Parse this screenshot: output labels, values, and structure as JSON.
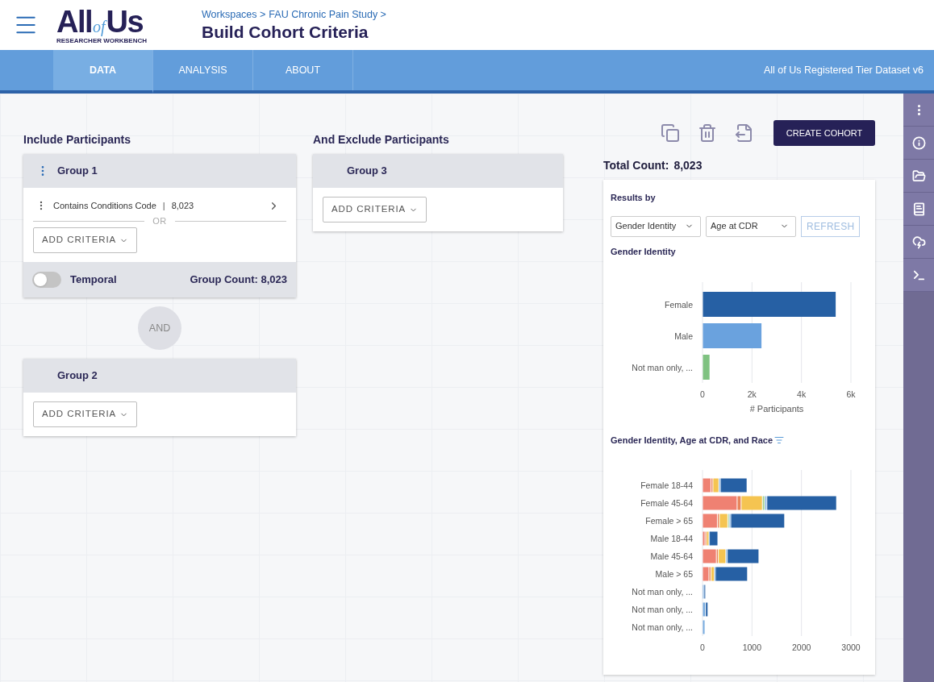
{
  "header": {
    "logo": {
      "word_all": "All",
      "word_of": "of",
      "word_us": "Us",
      "tagline": "RESEARCHER WORKBENCH"
    },
    "breadcrumb": [
      "Workspaces >",
      "FAU Chronic Pain Study >"
    ],
    "title": "Build Cohort Criteria"
  },
  "nav": {
    "tabs": [
      {
        "label": "DATA",
        "selected": true
      },
      {
        "label": "ANALYSIS",
        "selected": false
      },
      {
        "label": "ABOUT",
        "selected": false
      }
    ],
    "dataset": "All of Us Registered Tier Dataset v6"
  },
  "include": {
    "heading": "Include Participants",
    "groups": [
      {
        "title": "Group 1",
        "menu": true,
        "criteria": [
          {
            "label": "Contains Conditions Code",
            "divider": "|",
            "count": "8,023"
          }
        ],
        "separator": "OR",
        "add_label": "ADD CRITERIA",
        "footer": {
          "toggle_label": "Temporal",
          "on": false,
          "count": "Group Count: 8,023"
        }
      },
      {
        "title": "Group 2",
        "menu": false,
        "add_label": "ADD CRITERIA"
      }
    ],
    "joiner": "AND"
  },
  "exclude": {
    "heading": "And Exclude Participants",
    "groups": [
      {
        "title": "Group 3",
        "menu": false,
        "add_label": "ADD CRITERIA"
      }
    ]
  },
  "results": {
    "create_button": "CREATE COHORT",
    "total_label": "Total Count:",
    "total": "8,023",
    "results_by": "Results by",
    "selects": [
      {
        "value": "Gender Identity"
      },
      {
        "value": "Age at CDR"
      }
    ],
    "refresh": {
      "label": "REFRESH",
      "disabled": true
    },
    "chart1_title": "Gender Identity",
    "chart1": {
      "chart_data": {
        "type": "bar",
        "orientation": "horizontal",
        "xlabel": "# Participants",
        "categories": [
          "Female",
          "Male",
          "Not man only, ..."
        ],
        "xlim": [
          0,
          6000
        ],
        "xticks": [
          {
            "value": 0,
            "label": "0"
          },
          {
            "value": 2000,
            "label": "2k"
          },
          {
            "value": 4000,
            "label": "4k"
          },
          {
            "value": 6000,
            "label": "6k"
          }
        ],
        "series": [
          {
            "color": "#2660a4",
            "values": [
              5400,
              null,
              null
            ]
          },
          {
            "color": "#6aa2de",
            "values": [
              null,
              2400,
              null
            ]
          },
          {
            "color": "#7fc281",
            "values": [
              null,
              null,
              300
            ]
          }
        ]
      }
    },
    "chart2_title": "Gender Identity, Age at CDR, and Race",
    "chart2": {
      "chart_data": {
        "type": "bar",
        "orientation": "horizontal",
        "stacked": true,
        "categories": [
          "Female 18-44",
          "Female 45-64",
          "Female > 65",
          "Male 18-44",
          "Male 45-64",
          "Male > 65",
          "Not man only, ...",
          "Not man only, ...",
          "Not man only, ..."
        ],
        "xlim": [
          0,
          3000
        ],
        "xticks": [
          0,
          1000,
          2000,
          3000
        ],
        "series": [
          {
            "color": "#ef8172",
            "values": [
              170,
              700,
              300,
              50,
              280,
              130,
              0,
              0,
              0
            ]
          },
          {
            "color": "#e8845a",
            "values": [
              40,
              80,
              40,
              30,
              40,
              40,
              0,
              0,
              0
            ]
          },
          {
            "color": "#f5c451",
            "values": [
              120,
              430,
              170,
              50,
              150,
              70,
              0,
              0,
              0
            ]
          },
          {
            "color": "#a6d49a",
            "values": [
              0,
              50,
              30,
              0,
              0,
              0,
              0,
              0,
              0
            ]
          },
          {
            "color": "#79acdf",
            "values": [
              30,
              40,
              30,
              10,
              30,
              20,
              30,
              60,
              50
            ]
          },
          {
            "color": "#2660a4",
            "values": [
              540,
              1410,
              1090,
              170,
              640,
              650,
              20,
              50,
              0
            ]
          }
        ]
      }
    }
  }
}
